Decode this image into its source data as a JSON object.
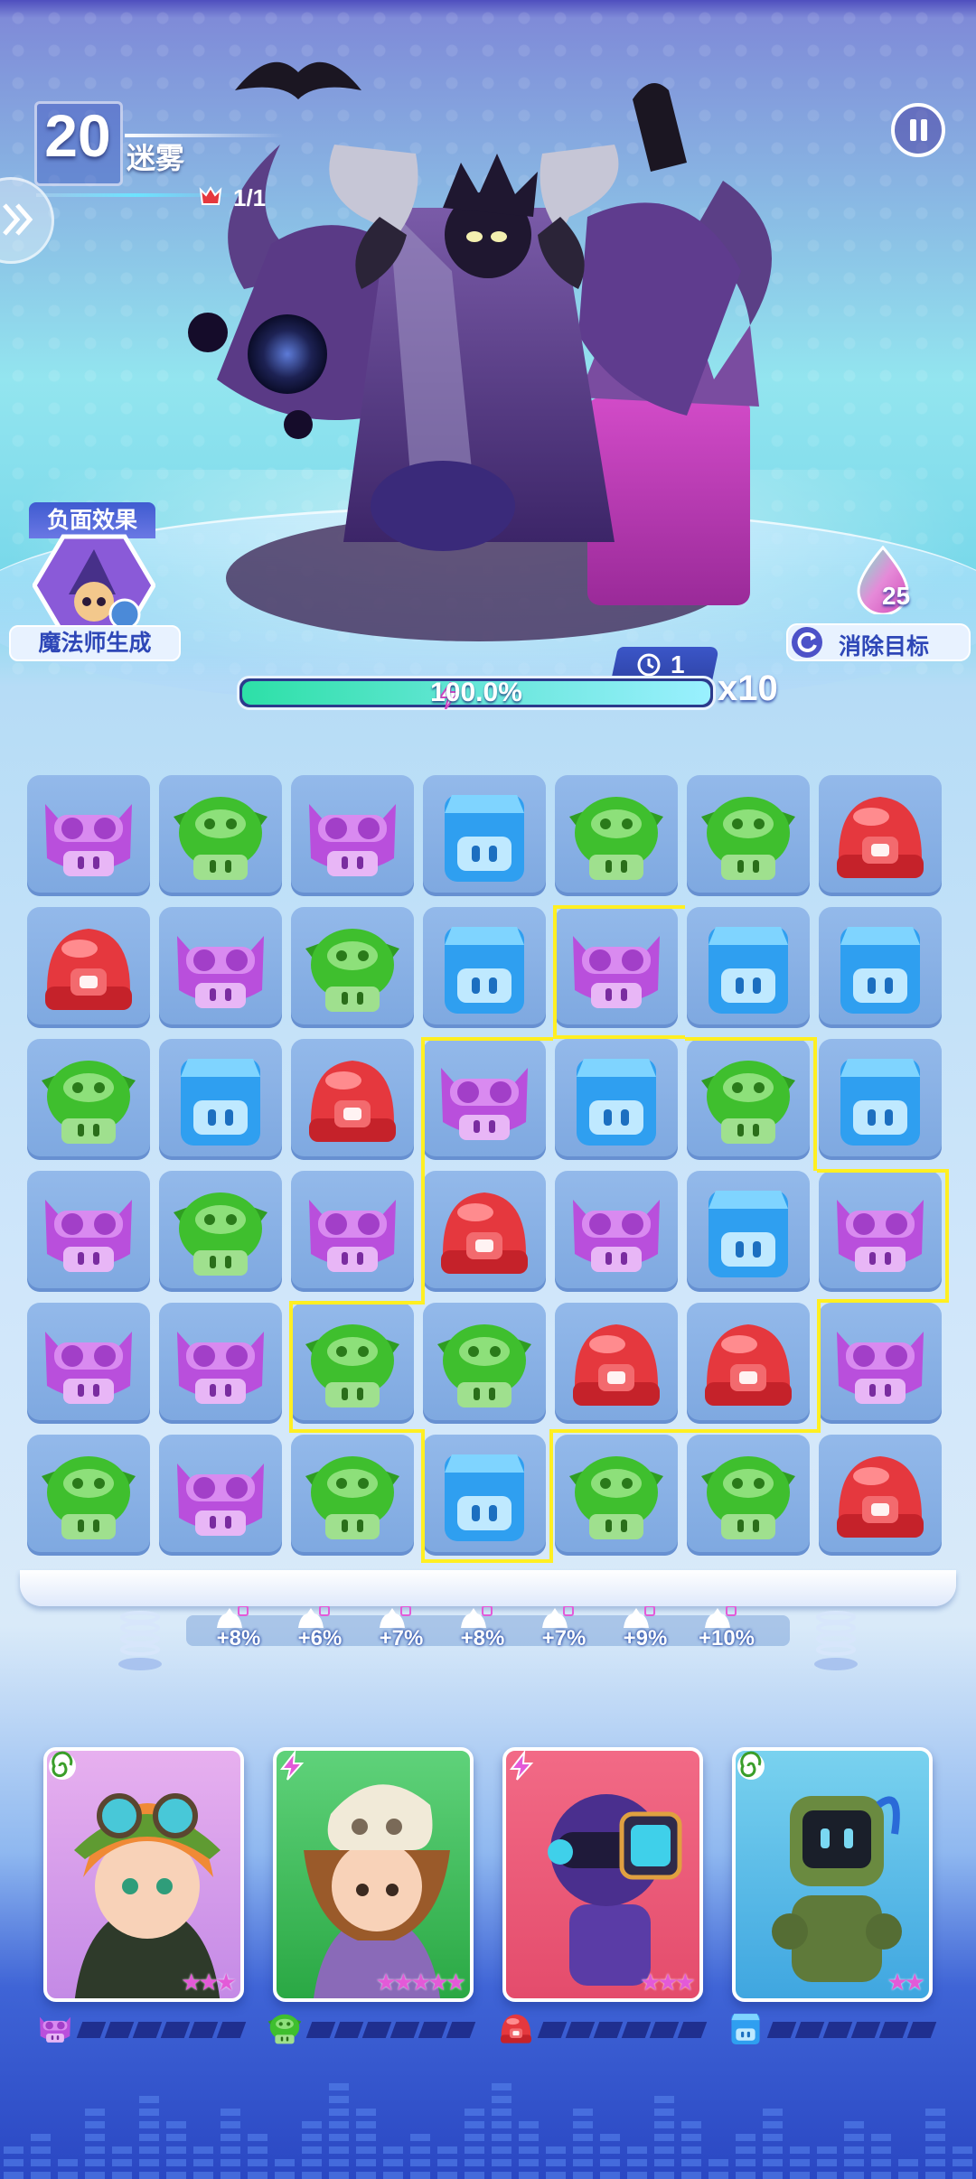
{
  "level": {
    "number": "20",
    "name": "迷雾",
    "wave": "1/1"
  },
  "debuff": {
    "title": "负面效果",
    "label": "魔法师生成"
  },
  "resources": {
    "drop_count": "25",
    "target_button": "消除目标"
  },
  "energy": {
    "timer": "1",
    "percent_text": "100.0%",
    "percent": 100.0,
    "multiplier": "x10"
  },
  "colors": {
    "purple": "#b94fdc",
    "green": "#3fbf2e",
    "blue": "#2f9ff0",
    "red": "#e5383e",
    "highlight": "#ffef22"
  },
  "board": {
    "rows": [
      [
        "purple",
        "green",
        "purple",
        "blue",
        "green",
        "green",
        "red"
      ],
      [
        "red",
        "purple",
        "green",
        "blue",
        "purple",
        "blue",
        "blue"
      ],
      [
        "green",
        "blue",
        "red",
        "purple",
        "blue",
        "green",
        "blue"
      ],
      [
        "purple",
        "green",
        "purple",
        "red",
        "purple",
        "blue",
        "purple"
      ],
      [
        "purple",
        "purple",
        "green",
        "green",
        "red",
        "red",
        "purple"
      ],
      [
        "green",
        "purple",
        "green",
        "blue",
        "green",
        "green",
        "red"
      ]
    ]
  },
  "bonuses": [
    "+8%",
    "+6%",
    "+7%",
    "+8%",
    "+7%",
    "+9%",
    "+10%"
  ],
  "heroes": [
    {
      "element": "green-swirl",
      "stars": "★★★",
      "color_slot": "purple",
      "icon": "goggles-girl-portrait"
    },
    {
      "element": "lightning",
      "stars": "★★★★★",
      "color_slot": "green",
      "icon": "skull-hat-girl-portrait"
    },
    {
      "element": "lightning",
      "stars": "★★★",
      "color_slot": "red",
      "icon": "robot-diver-portrait"
    },
    {
      "element": "green-swirl",
      "stars": "★★",
      "color_slot": "blue",
      "icon": "tv-robot-portrait"
    }
  ]
}
